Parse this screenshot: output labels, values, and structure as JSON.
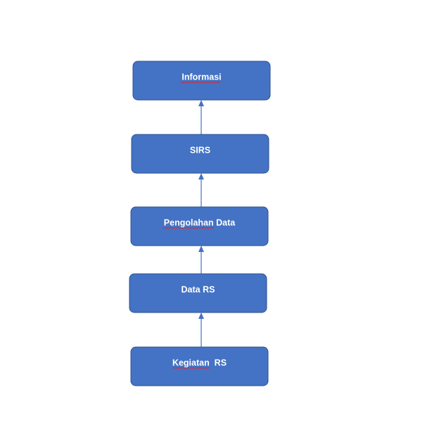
{
  "diagram": {
    "nodes": [
      {
        "id": "informasi",
        "label": "Informasi"
      },
      {
        "id": "sirs",
        "label": "SIRS"
      },
      {
        "id": "pengolahan",
        "label": "Pengolahan Data"
      },
      {
        "id": "data",
        "label": "Data RS"
      },
      {
        "id": "kegiatan",
        "label": "Kegiatan  RS"
      }
    ],
    "edges": [
      {
        "from": "kegiatan",
        "to": "data"
      },
      {
        "from": "data",
        "to": "pengolahan"
      },
      {
        "from": "pengolahan",
        "to": "sirs"
      },
      {
        "from": "sirs",
        "to": "informasi"
      }
    ],
    "colors": {
      "box_fill": "#4472c4",
      "box_stroke": "#2f528f",
      "label_text": "#ffffff",
      "arrow": "#4472c4",
      "spellcheck_underline": "#e0282e"
    }
  }
}
